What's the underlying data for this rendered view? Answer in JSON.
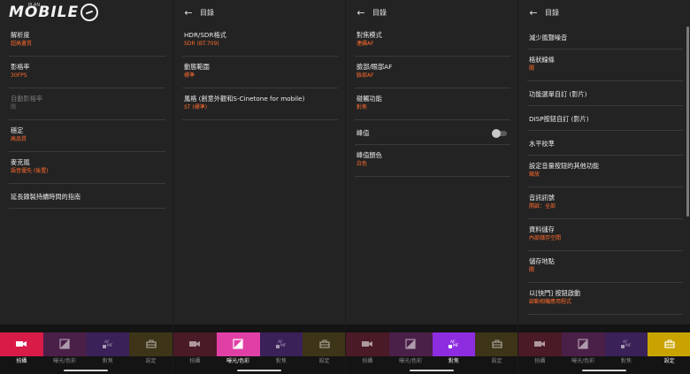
{
  "logo": {
    "text": "MOBILE",
    "sub": "PLAN"
  },
  "panels": [
    {
      "header": null,
      "items": [
        {
          "label": "解析度",
          "value": "超高畫質"
        },
        {
          "label": "影格率",
          "value": "30FPS"
        },
        {
          "label": "自動影格率",
          "value": "關",
          "disabled": true
        },
        {
          "label": "穩定",
          "value": "高品質"
        },
        {
          "label": "麥克風",
          "value": "語音優先 (後置)"
        },
        {
          "label": "延長錄製持續時間的指南",
          "value": ""
        }
      ],
      "active_tab": 0
    },
    {
      "header": "目錄",
      "items": [
        {
          "label": "HDR/SDR格式",
          "value": "SDR (BT.709)"
        },
        {
          "label": "動態範圍",
          "value": "標準"
        },
        {
          "label": "風格 (創意外觀和S-Cinetone for mobile)",
          "value": "ST (標準)"
        }
      ],
      "active_tab": 1
    },
    {
      "header": "目錄",
      "items": [
        {
          "label": "對焦模式",
          "value": "連續AF"
        },
        {
          "label": "臉部/眼部AF",
          "value": "臉部AF"
        },
        {
          "label": "碰觸功能",
          "value": "對焦"
        },
        {
          "label": "峰值",
          "value": "",
          "toggle": true
        },
        {
          "label": "峰值顏色",
          "value": "白色"
        }
      ],
      "active_tab": 2
    },
    {
      "header": "目錄",
      "items": [
        {
          "label": "減少風聲噪音",
          "value": ""
        },
        {
          "label": "格狀線條",
          "value": "關"
        },
        {
          "label": "功能選單自訂 (影片)",
          "value": ""
        },
        {
          "label": "DISP按鈕自訂 (影片)",
          "value": ""
        },
        {
          "label": "水平校準",
          "value": ""
        },
        {
          "label": "設定音量按鈕的其他功能",
          "value": "縮放"
        },
        {
          "label": "音訊訊號",
          "value": "開啟：全部"
        },
        {
          "label": "資料儲存",
          "value": "內部儲存空間"
        },
        {
          "label": "儲存地點",
          "value": "關"
        },
        {
          "label": "以[快門] 按鈕啟動",
          "value": "啟動相機應用程式"
        }
      ],
      "active_tab": 3
    }
  ],
  "tabs": [
    {
      "label": "拍攝",
      "icon": "video-camera-icon"
    },
    {
      "label": "曝光/色彩",
      "icon": "exposure-icon"
    },
    {
      "label": "對焦",
      "icon": "af-mf-icon"
    },
    {
      "label": "設定",
      "icon": "toolbox-icon"
    }
  ],
  "colors": {
    "accent": "#ff6b2d",
    "tab_active": [
      "#d81b47",
      "#e040a5",
      "#8e2de0",
      "#c9a400"
    ],
    "tab_dim": [
      "#4a1a26",
      "#4a2048",
      "#3a2158",
      "#3e3418"
    ]
  }
}
